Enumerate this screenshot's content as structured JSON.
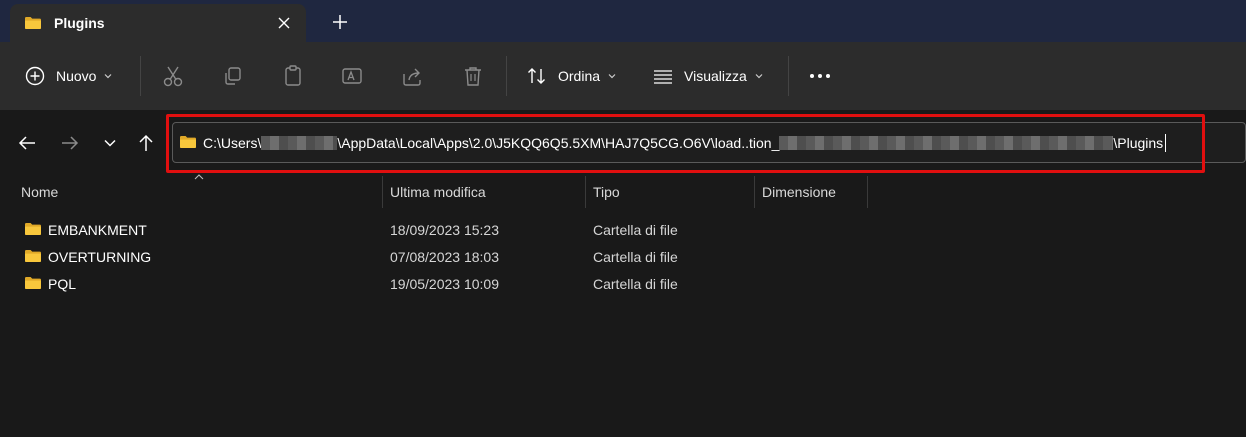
{
  "window": {
    "tab_title": "Plugins"
  },
  "toolbar": {
    "new_label": "Nuovo",
    "sort_label": "Ordina",
    "view_label": "Visualizza"
  },
  "address": {
    "path_prefix": "C:\\Users\\",
    "path_middle": "\\AppData\\Local\\Apps\\2.0\\J5KQQ6Q5.5XM\\HAJ7Q5CG.O6V\\load..tion_",
    "path_end": "\\Plugins"
  },
  "columns": {
    "name": "Nome",
    "modified": "Ultima modifica",
    "type": "Tipo",
    "size": "Dimensione"
  },
  "rows": [
    {
      "name": "EMBANKMENT",
      "modified": "18/09/2023 15:23",
      "type": "Cartella di file"
    },
    {
      "name": "OVERTURNING",
      "modified": "07/08/2023 18:03",
      "type": "Cartella di file"
    },
    {
      "name": "PQL",
      "modified": "19/05/2023 10:09",
      "type": "Cartella di file"
    }
  ],
  "colors": {
    "accent_highlight": "#e10f0f",
    "folder_yellow": "#f8c73c",
    "tabstrip_bg": "#1f2740",
    "toolbar_bg": "#2c2c2c",
    "content_bg": "#191919"
  },
  "icons": [
    "folder-icon",
    "close-icon",
    "plus-icon",
    "new-icon",
    "cut-icon",
    "copy-icon",
    "paste-icon",
    "rename-icon",
    "share-icon",
    "delete-icon",
    "sort-icon",
    "view-icon",
    "more-icon",
    "back-icon",
    "forward-icon",
    "recent-icon",
    "up-icon"
  ]
}
